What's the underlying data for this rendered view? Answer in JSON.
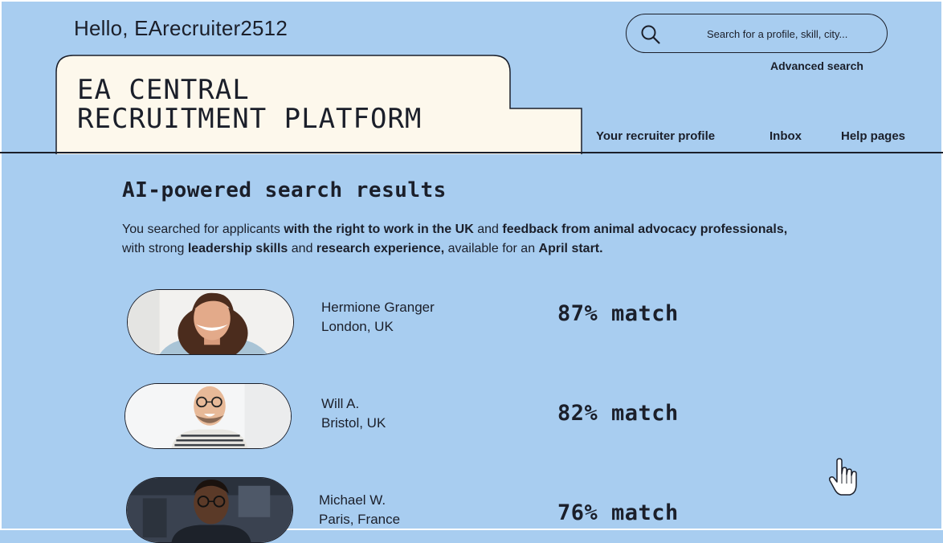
{
  "header": {
    "greeting": "Hello, EArecruiter2512",
    "platform_title": "EA CENTRAL\nRECRUITMENT PLATFORM"
  },
  "search": {
    "placeholder": "Search for a profile, skill, city...",
    "advanced_label": "Advanced search"
  },
  "nav": {
    "items": [
      {
        "label": "Your recruiter profile"
      },
      {
        "label": "Inbox"
      },
      {
        "label": "Help pages"
      }
    ]
  },
  "results": {
    "heading": "AI-powered search results",
    "query": {
      "p1": "You searched for applicants ",
      "b1": "with the right to work in the UK",
      "p2": " and ",
      "b2": "feedback from animal advocacy professionals,",
      "p3": " with strong ",
      "b3": "leadership skills",
      "p4": " and ",
      "b4": "research experience,",
      "p5": " available for an ",
      "b5": "April start."
    },
    "items": [
      {
        "name": "Hermione Granger",
        "location": "London, UK",
        "match": "87% match"
      },
      {
        "name": "Will A.",
        "location": "Bristol, UK",
        "match": "82% match"
      },
      {
        "name": "Michael W.",
        "location": "Paris, France",
        "match": "76% match"
      }
    ]
  },
  "icons": {
    "search": "search-icon",
    "cursor": "hand-pointer-icon"
  },
  "colors": {
    "background": "#a8cdf0",
    "title_panel": "#fdf8ec",
    "ink": "#1b1f2a"
  }
}
